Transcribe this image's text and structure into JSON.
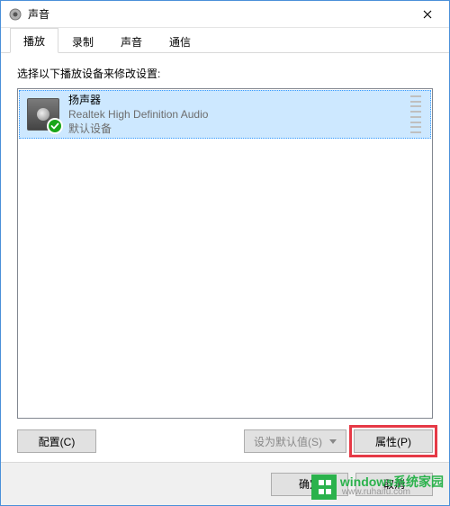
{
  "window": {
    "title": "声音"
  },
  "tabs": [
    {
      "label": "播放",
      "active": true
    },
    {
      "label": "录制",
      "active": false
    },
    {
      "label": "声音",
      "active": false
    },
    {
      "label": "通信",
      "active": false
    }
  ],
  "instruction": "选择以下播放设备来修改设置:",
  "devices": [
    {
      "name": "扬声器",
      "driver": "Realtek High Definition Audio",
      "status": "默认设备",
      "selected": true,
      "default": true
    }
  ],
  "buttons": {
    "configure": "配置(C)",
    "set_default": "设为默认值(S)",
    "properties": "属性(P)",
    "ok": "确定",
    "cancel": "取消"
  },
  "watermark": {
    "line1": "windows系统家园",
    "line2": "www.ruhaifu.com"
  }
}
